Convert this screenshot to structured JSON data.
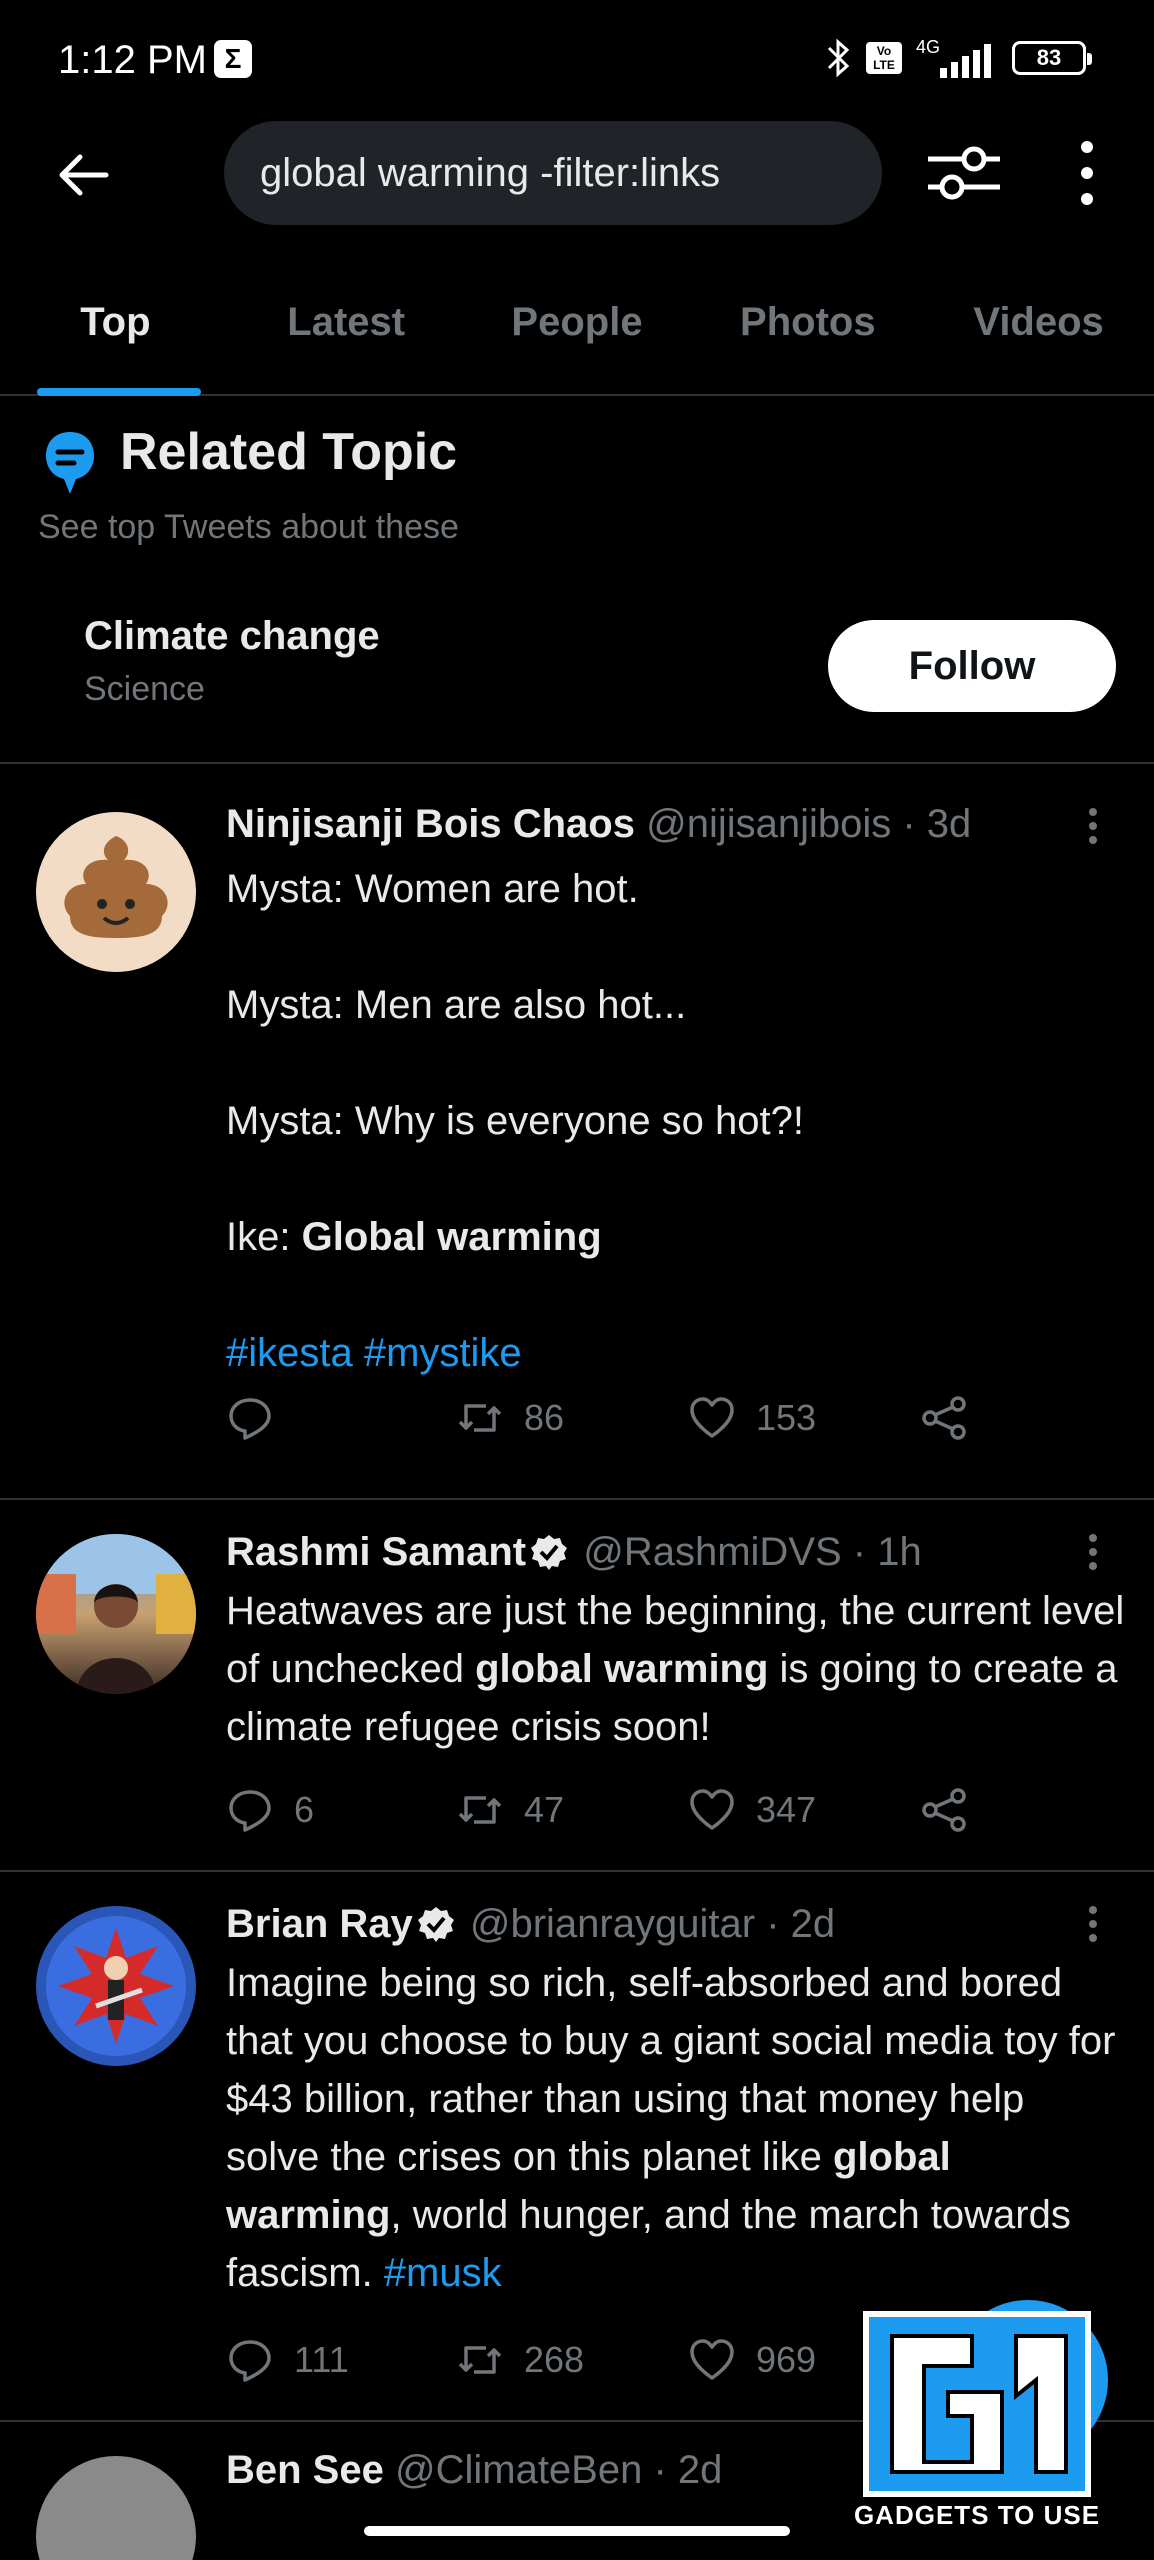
{
  "status_bar": {
    "time": "1:12 PM",
    "notif_badge": "Σ",
    "volte": "Vo LTE",
    "network": "4G",
    "battery": "83"
  },
  "search": {
    "query": "global warming -filter:links"
  },
  "tabs": [
    {
      "label": "Top",
      "active": true
    },
    {
      "label": "Latest",
      "active": false
    },
    {
      "label": "People",
      "active": false
    },
    {
      "label": "Photos",
      "active": false
    },
    {
      "label": "Videos",
      "active": false
    }
  ],
  "related_topic": {
    "title": "Related Topic",
    "subtitle": "See top Tweets about these",
    "topic_name": "Climate change",
    "topic_category": "Science",
    "follow_label": "Follow"
  },
  "tweets": [
    {
      "name": "Ninjisanji Bois Chaos",
      "handle": "@nijisanjibois",
      "time": "· 3d",
      "verified": false,
      "lines": [
        "Mysta: Women are hot.",
        "Mysta: Men are also hot...",
        "Mysta: Why is everyone so hot?!"
      ],
      "line4_prefix": "Ike: ",
      "line4_bold": "Global warming",
      "hashtags": "#ikesta #mystike",
      "replies": "",
      "retweets": "86",
      "likes": "153"
    },
    {
      "name": "Rashmi Samant",
      "handle": "@RashmiDVS",
      "time": "· 1h",
      "verified": true,
      "text_before": "Heatwaves are just the beginning, the current level of unchecked ",
      "text_bold": "global warming",
      "text_after": " is going to create a climate refugee crisis soon!",
      "replies": "6",
      "retweets": "47",
      "likes": "347"
    },
    {
      "name": "Brian Ray",
      "handle": "@brianrayguitar",
      "time": "· 2d",
      "verified": true,
      "text_before": "Imagine being so rich, self-absorbed and bored that you choose to buy a giant social media toy for $43 billion, rather than using that money help solve the crises on this planet like ",
      "text_bold": "global warming",
      "text_after": ", world hunger, and the march towards fascism. ",
      "hashtag": "#musk",
      "replies": "111",
      "retweets": "268",
      "likes": "969"
    },
    {
      "name": "Ben See",
      "handle": "@ClimateBen",
      "time": "· 2d"
    }
  ],
  "watermark": {
    "text": "GADGETS TO USE"
  }
}
